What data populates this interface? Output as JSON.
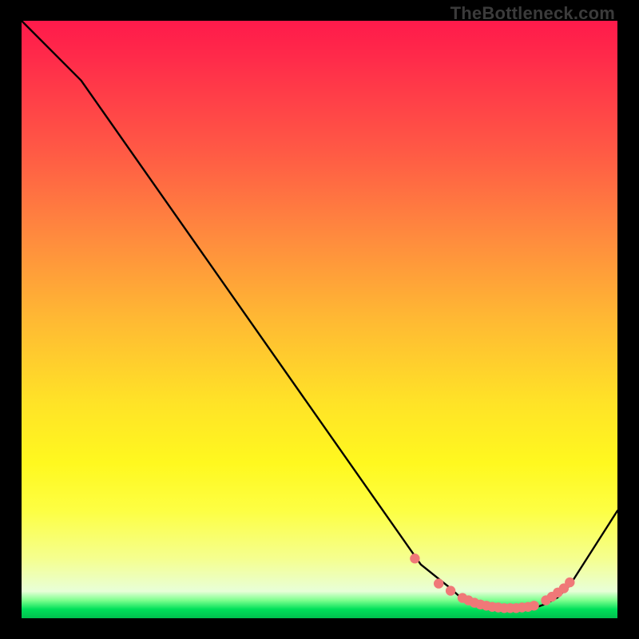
{
  "watermark": "TheBottleneck.com",
  "colors": {
    "line": "#000000",
    "marker_fill": "#f07878",
    "marker_stroke": "#c94f4f",
    "gradient_top": "#ff1a4b",
    "gradient_bottom": "#00c04e"
  },
  "chart_data": {
    "type": "line",
    "title": "",
    "xlabel": "",
    "ylabel": "",
    "xlim": [
      0,
      100
    ],
    "ylim": [
      0,
      100
    ],
    "series": [
      {
        "name": "curve",
        "x": [
          0,
          10,
          67,
          72,
          74,
          76,
          78,
          80,
          82,
          84,
          86,
          88,
          90,
          92,
          100
        ],
        "y": [
          100,
          90,
          9,
          5,
          3.2,
          2.2,
          1.7,
          1.4,
          1.3,
          1.4,
          1.7,
          2.4,
          3.5,
          5.5,
          18
        ]
      }
    ],
    "markers": {
      "name": "dots",
      "x": [
        66,
        70,
        72,
        74,
        75,
        76,
        77,
        78,
        79,
        80,
        81,
        82,
        83,
        84,
        85,
        86,
        88,
        89,
        90,
        91,
        92
      ],
      "y": [
        10,
        5.8,
        4.6,
        3.4,
        3.0,
        2.6,
        2.3,
        2.1,
        1.9,
        1.8,
        1.7,
        1.7,
        1.7,
        1.8,
        1.9,
        2.1,
        3.0,
        3.6,
        4.3,
        5.0,
        6.0
      ]
    }
  }
}
